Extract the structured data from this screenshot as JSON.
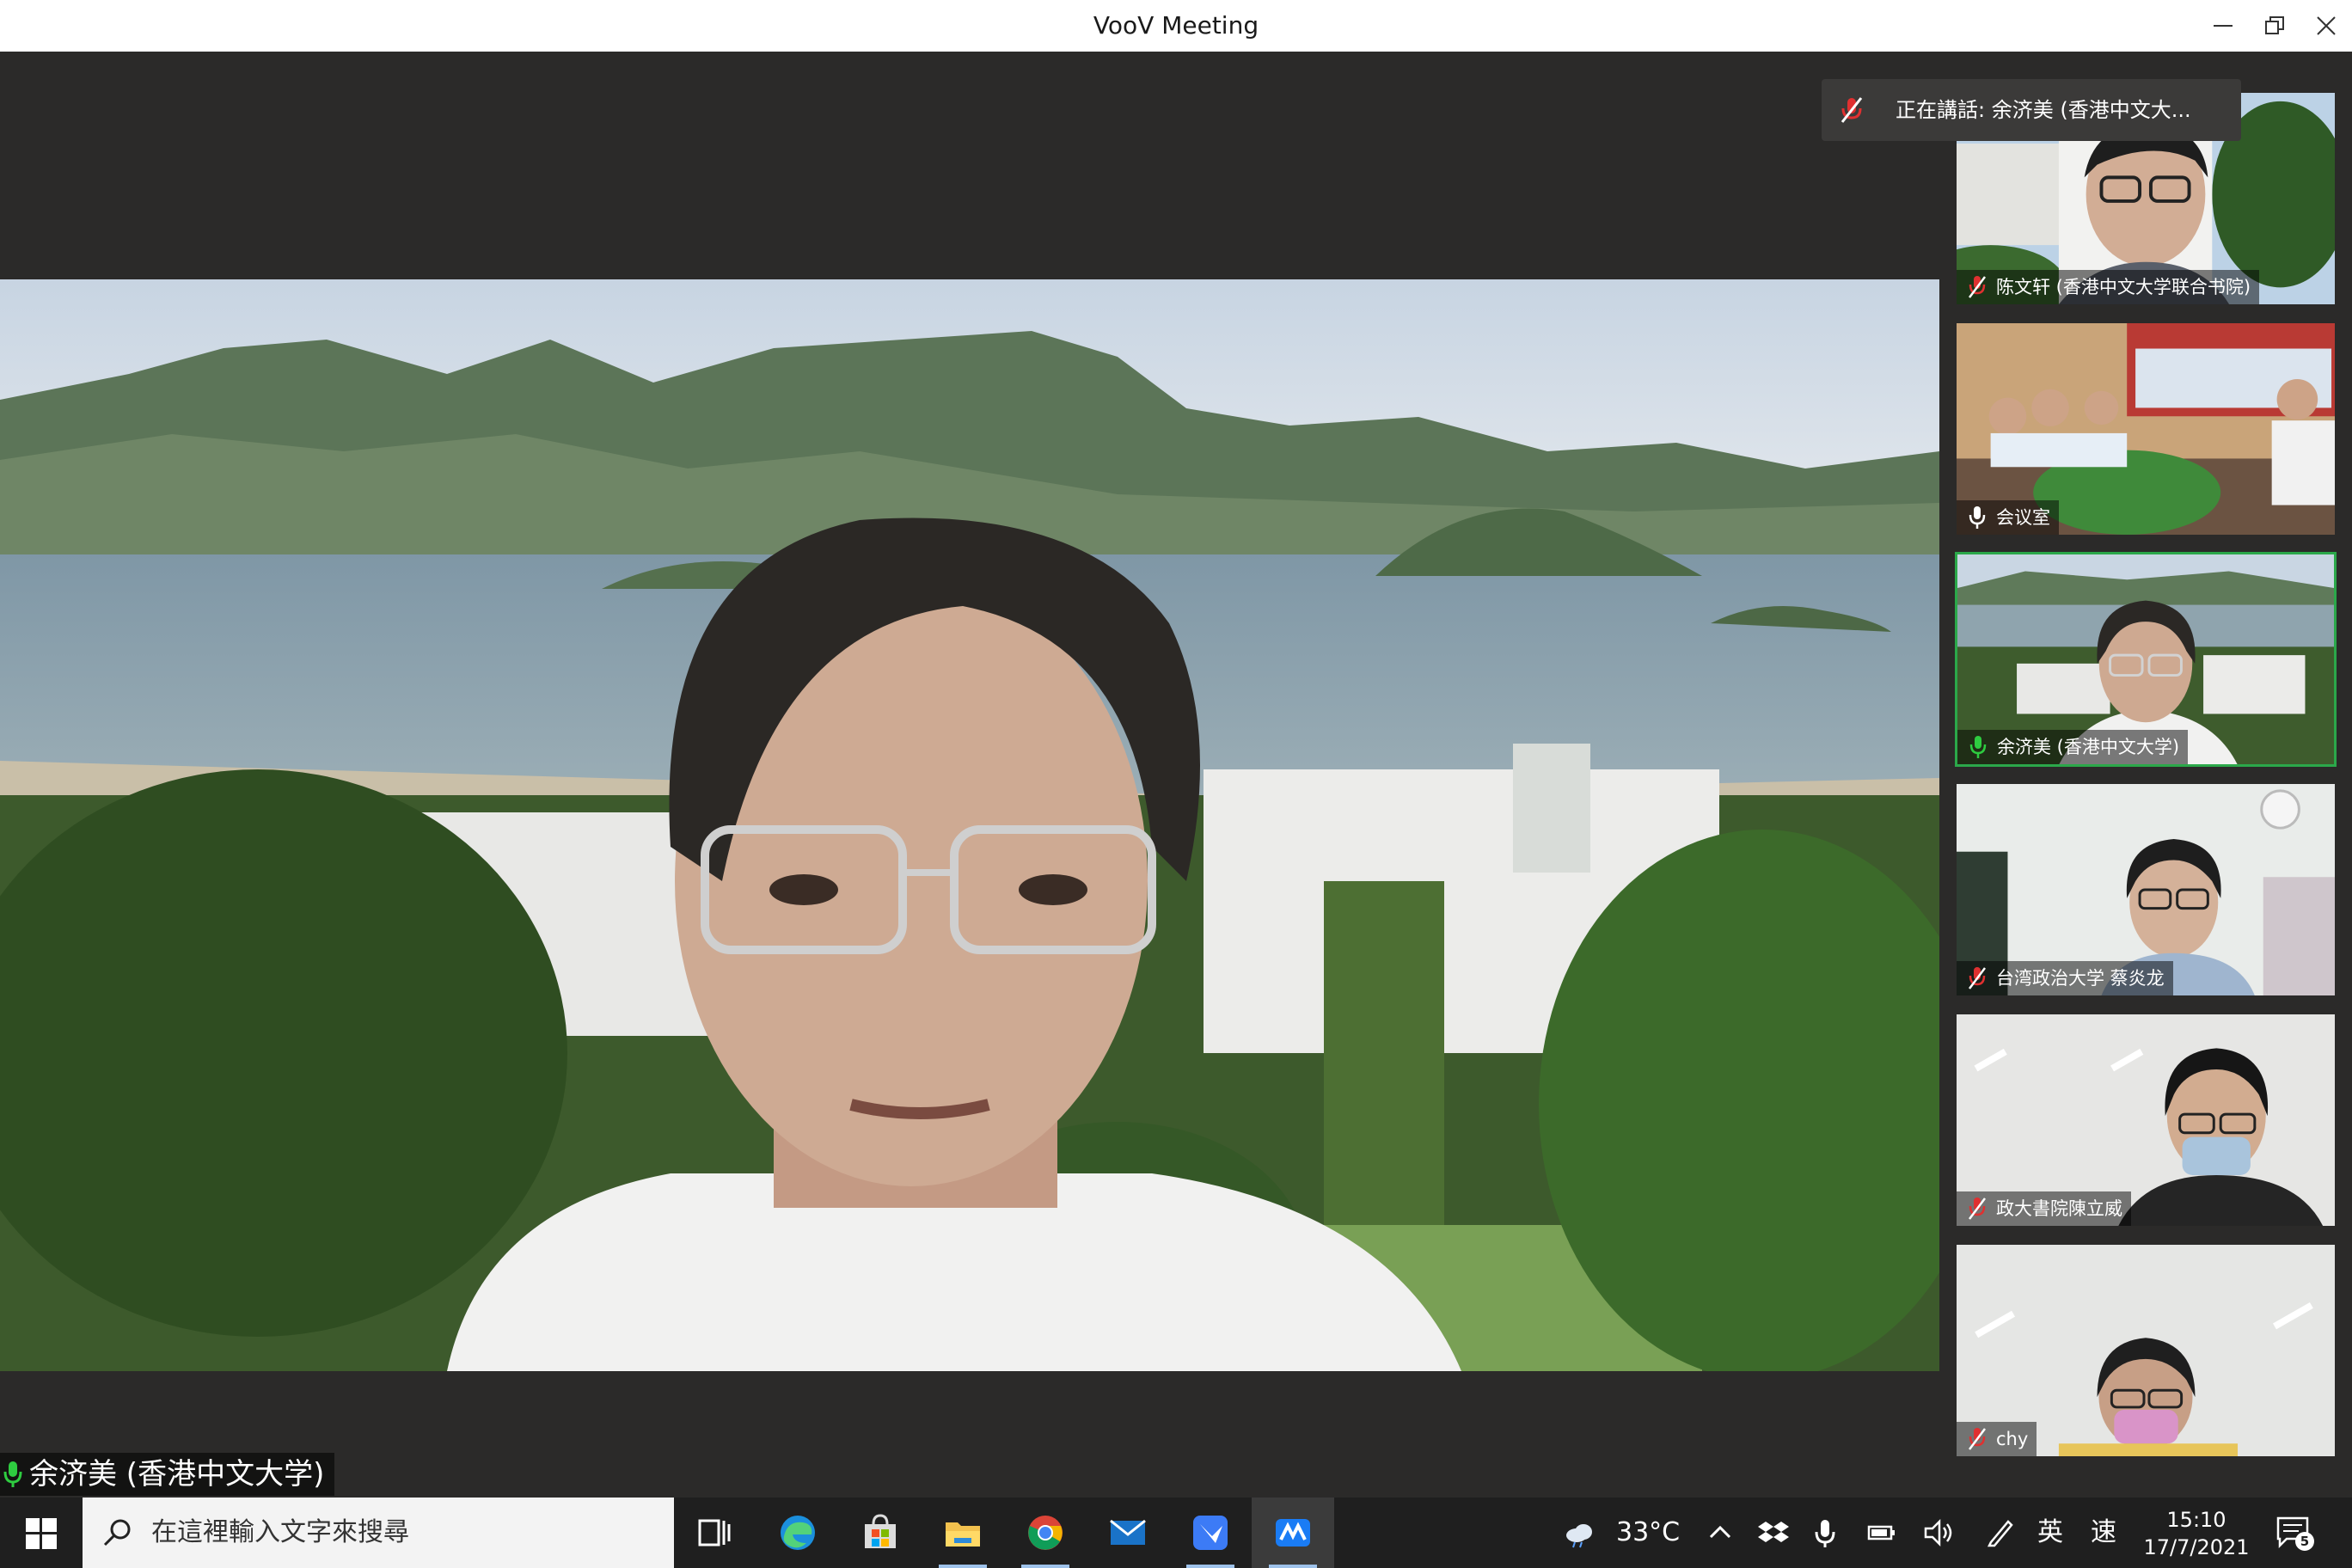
{
  "window": {
    "title": "VooV Meeting",
    "controls": [
      "minimize-icon",
      "restore-icon",
      "close-icon"
    ]
  },
  "speaking_banner": {
    "text": "正在講話: 余济美 (香港中文大..."
  },
  "main_video": {
    "participant_name": "余济美 (香港中文大学)",
    "mic": "mic-on"
  },
  "participants": [
    {
      "name": "陈文轩 (香港中文大学联合书院)",
      "mic": "mic-muted",
      "active": false
    },
    {
      "name": "会议室",
      "mic": "mic-on",
      "active": false
    },
    {
      "name": "余济美 (香港中文大学)",
      "mic": "mic-on",
      "active": true
    },
    {
      "name": "台湾政治大学 蔡炎龙",
      "mic": "mic-muted",
      "active": false
    },
    {
      "name": "政大書院陳立威",
      "mic": "mic-muted",
      "active": false
    },
    {
      "name": "chy",
      "mic": "mic-muted",
      "active": false
    }
  ],
  "taskbar": {
    "search_placeholder": "在這裡輸入文字來搜尋",
    "apps": [
      "task-view-icon",
      "edge-icon",
      "store-icon",
      "file-explorer-icon",
      "chrome-icon",
      "mail-icon",
      "feishu-icon",
      "voov-icon"
    ],
    "weather": "33°C",
    "ime_lang": "英",
    "ime_mode": "速",
    "time": "15:10",
    "date": "17/7/2021",
    "notification_count": "5"
  },
  "colors": {
    "active_border": "#2ba84a",
    "mic_on": "#2ecc40",
    "mic_muted": "#e03030"
  }
}
